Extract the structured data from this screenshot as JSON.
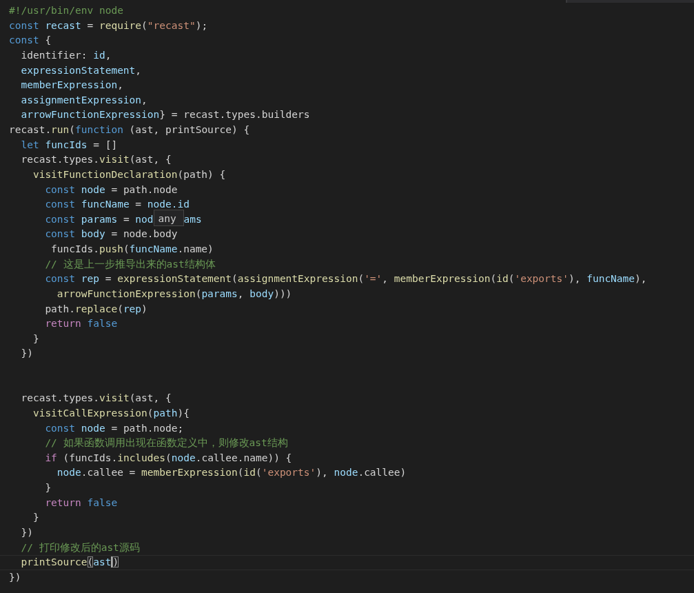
{
  "editor": {
    "lines": [
      {
        "tokens": [
          {
            "kind": "com",
            "text": "#!/usr/bin/env node"
          }
        ]
      },
      {
        "tokens": [
          {
            "kind": "kw",
            "text": "const"
          },
          {
            "kind": "var",
            "text": " recast"
          },
          {
            "kind": "txt",
            "text": " = "
          },
          {
            "kind": "fn",
            "text": "require"
          },
          {
            "kind": "txt",
            "text": "("
          },
          {
            "kind": "str",
            "text": "\"recast\""
          },
          {
            "kind": "txt",
            "text": ");"
          }
        ]
      },
      {
        "tokens": [
          {
            "kind": "kw",
            "text": "const"
          },
          {
            "kind": "txt",
            "text": " {"
          }
        ]
      },
      {
        "tokens": [
          {
            "kind": "txt",
            "text": "  identifier: "
          },
          {
            "kind": "var",
            "text": "id"
          },
          {
            "kind": "txt",
            "text": ","
          }
        ]
      },
      {
        "tokens": [
          {
            "kind": "var",
            "text": "  expressionStatement"
          },
          {
            "kind": "txt",
            "text": ","
          }
        ]
      },
      {
        "tokens": [
          {
            "kind": "var",
            "text": "  memberExpression"
          },
          {
            "kind": "txt",
            "text": ","
          }
        ]
      },
      {
        "tokens": [
          {
            "kind": "var",
            "text": "  assignmentExpression"
          },
          {
            "kind": "txt",
            "text": ","
          }
        ]
      },
      {
        "tokens": [
          {
            "kind": "var",
            "text": "  arrowFunctionExpression"
          },
          {
            "kind": "txt",
            "text": "} = recast.types.builders"
          }
        ]
      },
      {
        "tokens": [
          {
            "kind": "txt",
            "text": "recast."
          },
          {
            "kind": "fn",
            "text": "run"
          },
          {
            "kind": "txt",
            "text": "("
          },
          {
            "kind": "kw",
            "text": "function"
          },
          {
            "kind": "txt",
            "text": " (ast, printSource) {"
          }
        ]
      },
      {
        "tokens": [
          {
            "kind": "kw",
            "text": "  let"
          },
          {
            "kind": "var",
            "text": " funcIds"
          },
          {
            "kind": "txt",
            "text": " = []"
          }
        ]
      },
      {
        "tokens": [
          {
            "kind": "txt",
            "text": "  recast.types."
          },
          {
            "kind": "fn",
            "text": "visit"
          },
          {
            "kind": "txt",
            "text": "(ast, {"
          }
        ]
      },
      {
        "tokens": [
          {
            "kind": "fn",
            "text": "    visitFunctionDeclaration"
          },
          {
            "kind": "txt",
            "text": "(path) {"
          }
        ]
      },
      {
        "tokens": [
          {
            "kind": "kw",
            "text": "      const"
          },
          {
            "kind": "var",
            "text": " node"
          },
          {
            "kind": "txt",
            "text": " = path.node"
          }
        ]
      },
      {
        "tokens": [
          {
            "kind": "kw",
            "text": "      const"
          },
          {
            "kind": "var",
            "text": " funcName"
          },
          {
            "kind": "txt",
            "text": " = "
          },
          {
            "kind": "var",
            "text": "node.id"
          }
        ]
      },
      {
        "tokens": [
          {
            "kind": "kw",
            "text": "      const"
          },
          {
            "kind": "var",
            "text": " params"
          },
          {
            "kind": "txt",
            "text": " = "
          },
          {
            "kind": "var",
            "text": "nod"
          }
        ],
        "tooltip": "any",
        "after": [
          {
            "kind": "var",
            "text": "ams"
          }
        ]
      },
      {
        "tokens": [
          {
            "kind": "kw",
            "text": "      const"
          },
          {
            "kind": "var",
            "text": " body"
          },
          {
            "kind": "txt",
            "text": " = node.body"
          }
        ]
      },
      {
        "tokens": [
          {
            "kind": "txt",
            "text": "       funcIds."
          },
          {
            "kind": "fn",
            "text": "push"
          },
          {
            "kind": "txt",
            "text": "("
          },
          {
            "kind": "var",
            "text": "funcName"
          },
          {
            "kind": "txt",
            "text": ".name)"
          }
        ]
      },
      {
        "tokens": [
          {
            "kind": "com",
            "text": "      // 这是上一步推导出来的ast结构体"
          }
        ]
      },
      {
        "tokens": [
          {
            "kind": "kw",
            "text": "      const"
          },
          {
            "kind": "var",
            "text": " rep"
          },
          {
            "kind": "txt",
            "text": " = "
          },
          {
            "kind": "fn",
            "text": "expressionStatement"
          },
          {
            "kind": "txt",
            "text": "("
          },
          {
            "kind": "fn",
            "text": "assignmentExpression"
          },
          {
            "kind": "txt",
            "text": "("
          },
          {
            "kind": "str",
            "text": "'='"
          },
          {
            "kind": "txt",
            "text": ", "
          },
          {
            "kind": "fn",
            "text": "memberExpression"
          },
          {
            "kind": "txt",
            "text": "("
          },
          {
            "kind": "fn",
            "text": "id"
          },
          {
            "kind": "txt",
            "text": "("
          },
          {
            "kind": "str",
            "text": "'exports'"
          },
          {
            "kind": "txt",
            "text": "), "
          },
          {
            "kind": "var",
            "text": "funcName"
          },
          {
            "kind": "txt",
            "text": "),"
          }
        ]
      },
      {
        "tokens": [
          {
            "kind": "fn",
            "text": "        arrowFunctionExpression"
          },
          {
            "kind": "txt",
            "text": "("
          },
          {
            "kind": "var",
            "text": "params"
          },
          {
            "kind": "txt",
            "text": ", "
          },
          {
            "kind": "var",
            "text": "body"
          },
          {
            "kind": "txt",
            "text": ")))"
          }
        ]
      },
      {
        "tokens": [
          {
            "kind": "txt",
            "text": "      path."
          },
          {
            "kind": "fn",
            "text": "replace"
          },
          {
            "kind": "txt",
            "text": "("
          },
          {
            "kind": "var",
            "text": "rep"
          },
          {
            "kind": "txt",
            "text": ")"
          }
        ]
      },
      {
        "tokens": [
          {
            "kind": "ctl",
            "text": "      return"
          },
          {
            "kind": "kw",
            "text": " false"
          }
        ]
      },
      {
        "tokens": [
          {
            "kind": "txt",
            "text": "    }"
          }
        ]
      },
      {
        "tokens": [
          {
            "kind": "txt",
            "text": "  })"
          }
        ]
      },
      {
        "kind": "blank"
      },
      {
        "kind": "blank"
      },
      {
        "tokens": [
          {
            "kind": "txt",
            "text": "  recast.types."
          },
          {
            "kind": "fn",
            "text": "visit"
          },
          {
            "kind": "txt",
            "text": "(ast, {"
          }
        ]
      },
      {
        "tokens": [
          {
            "kind": "fn",
            "text": "    visitCallExpression"
          },
          {
            "kind": "txt",
            "text": "("
          },
          {
            "kind": "var",
            "text": "path"
          },
          {
            "kind": "txt",
            "text": "){"
          }
        ]
      },
      {
        "tokens": [
          {
            "kind": "kw",
            "text": "      const"
          },
          {
            "kind": "var",
            "text": " node"
          },
          {
            "kind": "txt",
            "text": " = path.node;"
          }
        ]
      },
      {
        "tokens": [
          {
            "kind": "com",
            "text": "      // 如果函数调用出现在函数定义中，则修改ast结构"
          }
        ]
      },
      {
        "tokens": [
          {
            "kind": "ctl",
            "text": "      if"
          },
          {
            "kind": "txt",
            "text": " (funcIds."
          },
          {
            "kind": "fn",
            "text": "includes"
          },
          {
            "kind": "txt",
            "text": "("
          },
          {
            "kind": "var",
            "text": "node"
          },
          {
            "kind": "txt",
            "text": ".callee.name)) {"
          }
        ]
      },
      {
        "tokens": [
          {
            "kind": "var",
            "text": "        node"
          },
          {
            "kind": "txt",
            "text": ".callee = "
          },
          {
            "kind": "fn",
            "text": "memberExpression"
          },
          {
            "kind": "txt",
            "text": "("
          },
          {
            "kind": "fn",
            "text": "id"
          },
          {
            "kind": "txt",
            "text": "("
          },
          {
            "kind": "str",
            "text": "'exports'"
          },
          {
            "kind": "txt",
            "text": "), "
          },
          {
            "kind": "var",
            "text": "node"
          },
          {
            "kind": "txt",
            "text": ".callee)"
          }
        ]
      },
      {
        "tokens": [
          {
            "kind": "txt",
            "text": "      }"
          }
        ]
      },
      {
        "tokens": [
          {
            "kind": "ctl",
            "text": "      return"
          },
          {
            "kind": "kw",
            "text": " false"
          }
        ]
      },
      {
        "tokens": [
          {
            "kind": "txt",
            "text": "    }"
          }
        ]
      },
      {
        "tokens": [
          {
            "kind": "txt",
            "text": "  })"
          }
        ]
      },
      {
        "tokens": [
          {
            "kind": "com",
            "text": "  // 打印修改后的ast源码"
          }
        ]
      },
      {
        "tokens": [
          {
            "kind": "fn",
            "text": "  printSource"
          },
          {
            "kind": "bm",
            "text": "("
          },
          {
            "kind": "var",
            "text": "ast",
            "cursor": true
          },
          {
            "kind": "bm",
            "text": ")"
          }
        ],
        "current": true
      },
      {
        "tokens": [
          {
            "kind": "txt",
            "text": "})"
          }
        ]
      }
    ]
  }
}
